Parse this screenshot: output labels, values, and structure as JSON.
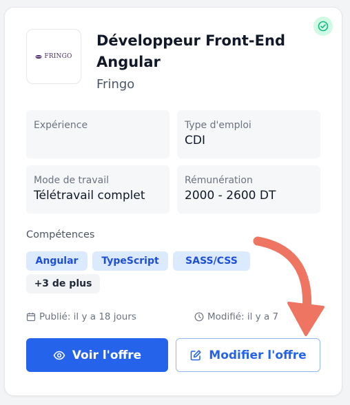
{
  "job": {
    "title": "Développeur Front-End Angular",
    "company": "Fringo",
    "logo_text": "FRINGO"
  },
  "details": {
    "experience": {
      "label": "Expérience",
      "value": ""
    },
    "employment_type": {
      "label": "Type d'emploi",
      "value": "CDI"
    },
    "work_mode": {
      "label": "Mode de travail",
      "value": "Télétravail complet"
    },
    "salary": {
      "label": "Rémunération",
      "value": "2000 - 2600 DT"
    }
  },
  "skills": {
    "label": "Compétences",
    "items": [
      "Angular",
      "TypeScript",
      "SASS/CSS"
    ],
    "more": "+3 de plus"
  },
  "meta": {
    "published": "Publié: il y a 18 jours",
    "modified": "Modifié: il y a 7"
  },
  "actions": {
    "view": "Voir l'offre",
    "edit": "Modifier l'offre"
  },
  "colors": {
    "primary": "#2563eb",
    "chip_bg": "#dbeafe",
    "verified": "#10b981",
    "annotation_arrow": "#ee7562"
  },
  "icons": {
    "verified": "check-circle-icon",
    "published": "calendar-icon",
    "modified": "clock-icon",
    "view": "eye-icon",
    "edit": "edit-icon"
  }
}
